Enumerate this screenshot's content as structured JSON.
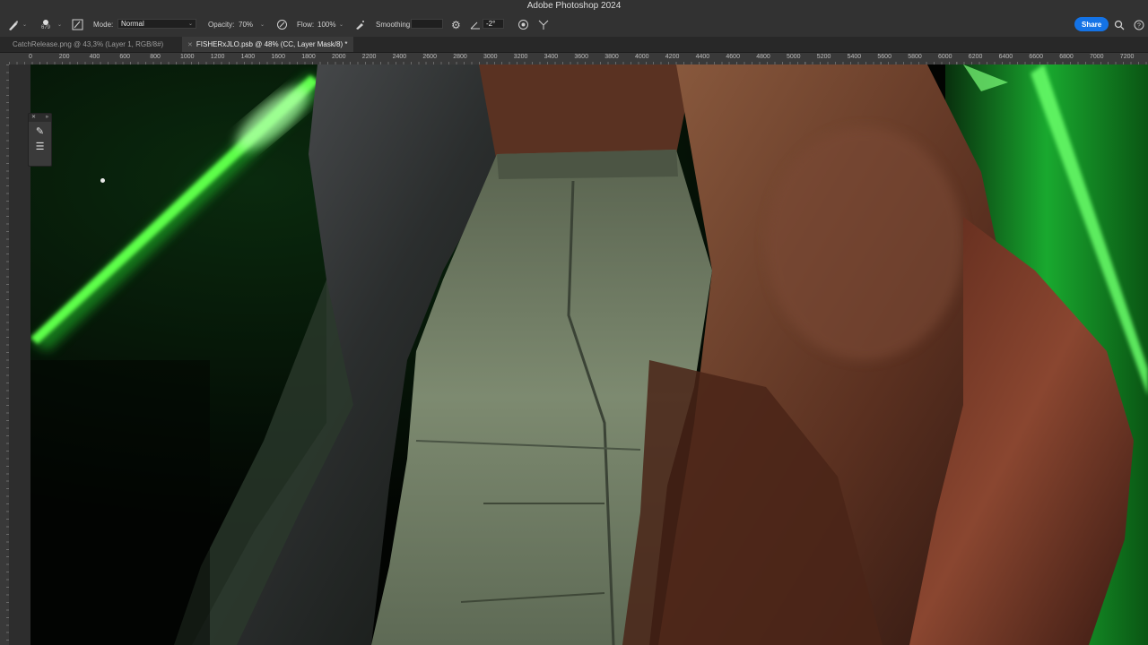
{
  "app": {
    "title": "Adobe Photoshop 2024"
  },
  "options_bar": {
    "brush_size": "679",
    "mode_label": "Mode:",
    "mode_value": "Normal",
    "opacity_label": "Opacity:",
    "opacity_value": "70%",
    "flow_label": "Flow:",
    "flow_value": "100%",
    "smoothing_label": "Smoothing:",
    "smoothing_value": "",
    "angle_value": "-2°",
    "share_label": "Share"
  },
  "tabs": [
    {
      "label": "CatchRelease.png @ 43,3% (Layer 1, RGB/8#)"
    },
    {
      "label": "FISHERxJLO.psb @ 48% (CC, Layer Mask/8) *"
    }
  ],
  "ruler": {
    "ticks": [
      "0",
      "200",
      "400",
      "600",
      "800",
      "1000",
      "1200",
      "1400",
      "1600",
      "1800",
      "2000",
      "2200",
      "2400",
      "2600",
      "2800",
      "3000",
      "3200",
      "3400",
      "3600",
      "3800",
      "4000",
      "4200",
      "4400",
      "4600",
      "4800",
      "5000",
      "5200",
      "5400",
      "5600",
      "5800",
      "6000",
      "6200",
      "6400",
      "6600",
      "6800",
      "7000",
      "7200"
    ]
  },
  "icons": {
    "brush": "brush-icon",
    "brush_panel": "brush-settings-icon",
    "airbrush": "airbrush-icon",
    "pressure": "pressure-icon",
    "gear": "gear-icon",
    "angle": "angle-icon",
    "symmetry": "symmetry-icon",
    "search": "search-icon",
    "help": "help-icon"
  },
  "colors": {
    "accent": "#1473e6",
    "neon": "#33ff33"
  }
}
